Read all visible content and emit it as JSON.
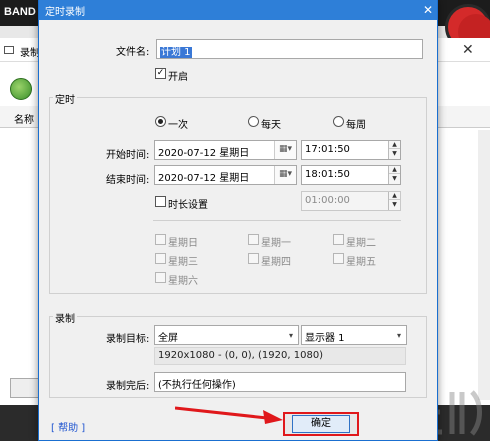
{
  "background": {
    "brand": "BAND",
    "window_title_fragment": "录制",
    "column_name": "名称"
  },
  "dialog": {
    "title": "定时录制",
    "close_glyph": "✕",
    "name_label": "文件名:",
    "name_value": "计划 1",
    "enable_label": "开启",
    "enable_checked": true,
    "schedule": {
      "group_title": "定时",
      "frequency_options": [
        "一次",
        "每天",
        "每周"
      ],
      "frequency_selected": "一次",
      "start_label": "开始时间:",
      "start_date": "2020-07-12 星期日",
      "start_time": "17:01:50",
      "end_label": "结束时间:",
      "end_date": "2020-07-12 星期日",
      "end_time": "18:01:50",
      "duration_label": "时长设置",
      "duration_checked": false,
      "duration_value": "01:00:00",
      "weekdays": [
        "星期日",
        "星期一",
        "星期二",
        "星期三",
        "星期四",
        "星期五",
        "星期六"
      ]
    },
    "recording": {
      "group_title": "录制",
      "target_label": "录制目标:",
      "target_value": "全屏",
      "display_value": "显示器 1",
      "resolution_text": "1920x1080 - (0, 0), (1920, 1080)",
      "after_label": "录制完后:",
      "after_value": "(不执行任何操作)"
    },
    "help_label": "[ 帮助 ]",
    "ok_label": "确定"
  },
  "colors": {
    "title_bar": "#2e7fd8",
    "ok_highlight": "#e0181b",
    "selection": "#3a78d6"
  }
}
